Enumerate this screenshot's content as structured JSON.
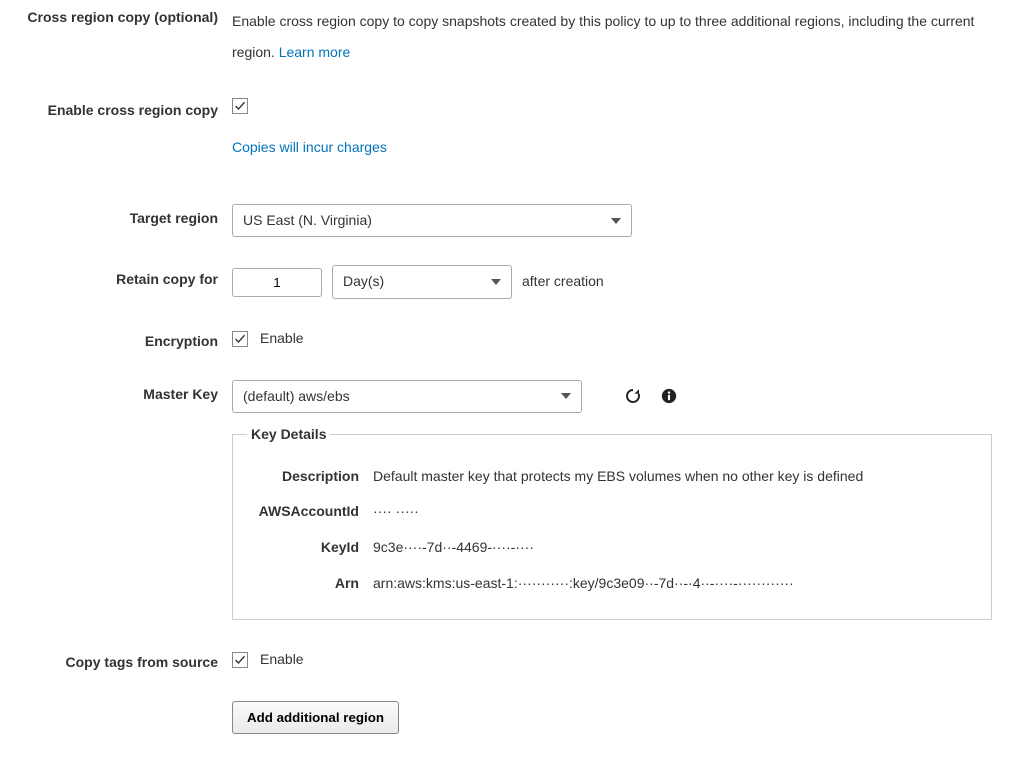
{
  "section": {
    "title": "Cross region copy (optional)"
  },
  "desc": {
    "text_a": "Enable cross region copy to copy snapshots created by this policy to up to three additional regions, including the current region. ",
    "learn_more": "Learn more"
  },
  "enable_copy": {
    "label": "Enable cross region copy"
  },
  "copies_notice": "Copies will incur charges",
  "target_region": {
    "label": "Target region",
    "value": "US East (N. Virginia)"
  },
  "retain": {
    "label": "Retain copy for",
    "count": "1",
    "unit": "Day(s)",
    "suffix": "after creation"
  },
  "encryption": {
    "label": "Encryption",
    "enable_text": "Enable"
  },
  "master_key": {
    "label": "Master Key",
    "value": "(default) aws/ebs"
  },
  "key_details": {
    "legend": "Key Details",
    "desc_label": "Description",
    "desc_value": "Default master key that protects my EBS volumes when no other key is defined",
    "acct_label": "AWSAccountId",
    "acct_value": "···· ·····",
    "keyid_label": "KeyId",
    "keyid_value": "9c3e····-7d··-4469-····-····",
    "arn_label": "Arn",
    "arn_value": "arn:aws:kms:us-east-1:···········:key/9c3e09··-7d··-·4··-····-············"
  },
  "copy_tags": {
    "label": "Copy tags from source",
    "enable_text": "Enable"
  },
  "add_region_btn": "Add additional region"
}
